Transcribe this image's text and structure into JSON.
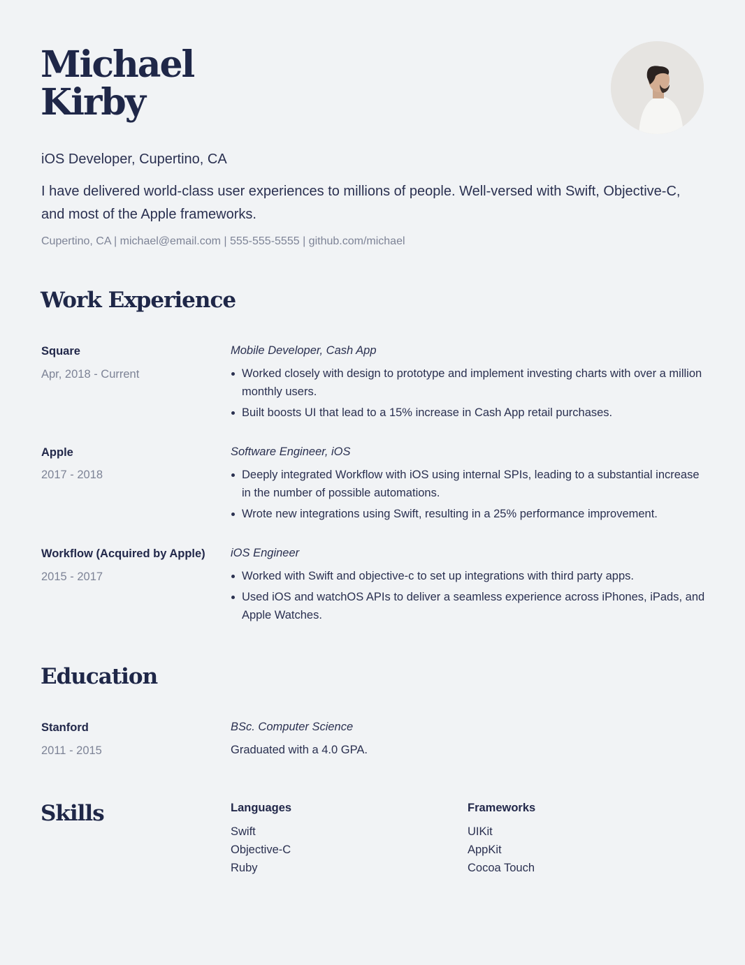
{
  "header": {
    "first_name": "Michael",
    "last_name": "Kirby",
    "headline": "iOS Developer, Cupertino, CA",
    "summary": "I have delivered world-class user experiences to millions of people. Well-versed with Swift, Objective-C, and most of the Apple frameworks.",
    "contact": "Cupertino, CA | michael@email.com | 555-555-5555 | github.com/michael"
  },
  "work": {
    "title": "Work Experience",
    "jobs": [
      {
        "company": "Square",
        "dates": "Apr, 2018 - Current",
        "role": "Mobile Developer, Cash App",
        "bullets": [
          "Worked closely with design to prototype and implement investing charts with over a million monthly users.",
          "Built boosts UI that lead to a 15% increase in Cash App retail purchases."
        ]
      },
      {
        "company": "Apple",
        "dates": "2017 - 2018",
        "role": "Software Engineer, iOS",
        "bullets": [
          "Deeply integrated Workflow with iOS using internal SPIs, leading to a substantial increase in the number of possible automations.",
          "Wrote new integrations using Swift, resulting in a 25% performance improvement."
        ]
      },
      {
        "company": "Workflow (Acquired by Apple)",
        "dates": "2015 - 2017",
        "role": "iOS Engineer",
        "bullets": [
          "Worked with Swift and objective-c to set up integrations with third party apps.",
          "Used iOS and watchOS APIs to deliver a seamless experience across iPhones, iPads, and Apple Watches."
        ]
      }
    ]
  },
  "education": {
    "title": "Education",
    "school": "Stanford",
    "dates": "2011 - 2015",
    "degree": "BSc. Computer Science",
    "detail": "Graduated with a 4.0 GPA."
  },
  "skills": {
    "title": "Skills",
    "languages_title": "Languages",
    "languages": [
      "Swift",
      "Objective-C",
      "Ruby"
    ],
    "frameworks_title": "Frameworks",
    "frameworks": [
      "UIKit",
      "AppKit",
      "Cocoa Touch"
    ]
  },
  "colors": {
    "background": "#f1f3f5",
    "heading": "#1f2748",
    "text": "#2a3050",
    "muted": "#7d8396"
  }
}
